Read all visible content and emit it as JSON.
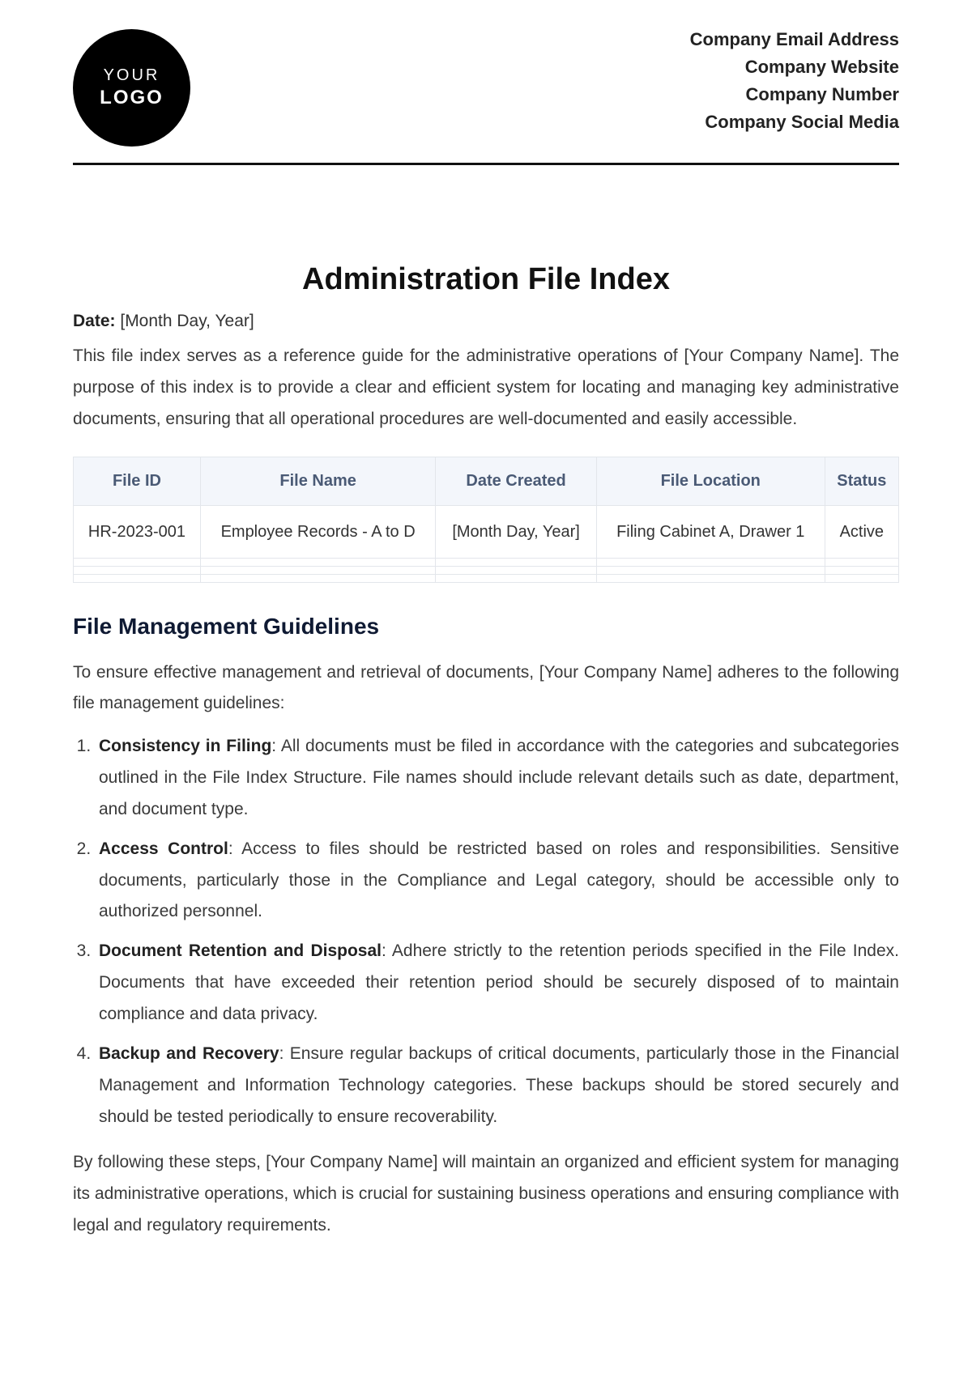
{
  "logo": {
    "line1": "YOUR",
    "line2": "LOGO"
  },
  "company_info": [
    "Company Email Address",
    "Company Website",
    "Company Number",
    "Company Social Media"
  ],
  "title": "Administration File Index",
  "date": {
    "label": "Date:",
    "value": "[Month Day, Year]"
  },
  "intro": "This file index serves as a reference guide for the administrative operations of [Your Company Name]. The purpose of this index is to provide a clear and efficient system for locating and managing key administrative documents, ensuring that all operational procedures are well-documented and easily accessible.",
  "table": {
    "headers": [
      "File ID",
      "File Name",
      "Date Created",
      "File Location",
      "Status"
    ],
    "rows": [
      {
        "file_id": "HR-2023-001",
        "file_name": "Employee Records - A to D",
        "date_created": "[Month Day, Year]",
        "file_location": "Filing Cabinet A, Drawer 1",
        "status": "Active"
      }
    ],
    "empty_rows": 3
  },
  "guidelines_heading": "File Management Guidelines",
  "guidelines_intro": "To ensure effective management and retrieval of documents, [Your Company Name] adheres to the following file management guidelines:",
  "guidelines": [
    {
      "title": "Consistency in Filing",
      "body": ": All documents must be filed in accordance with the categories and subcategories outlined in the File Index Structure. File names should include relevant details such as date, department, and document type."
    },
    {
      "title": "Access Control",
      "body": ": Access to files should be restricted based on roles and responsibilities. Sensitive documents, particularly those in the Compliance and Legal category, should be accessible only to authorized personnel."
    },
    {
      "title": "Document Retention and Disposal",
      "body": ": Adhere strictly to the retention periods specified in the File Index. Documents that have exceeded their retention period should be securely disposed of to maintain compliance and data privacy."
    },
    {
      "title": "Backup and Recovery",
      "body": ": Ensure regular backups of critical documents, particularly those in the Financial Management and Information Technology categories. These backups should be stored securely and should be tested periodically to ensure recoverability."
    }
  ],
  "conclusion": "By following these steps, [Your Company Name] will maintain an organized and efficient system for managing its administrative operations, which is crucial for sustaining business operations and ensuring compliance with legal and regulatory requirements."
}
